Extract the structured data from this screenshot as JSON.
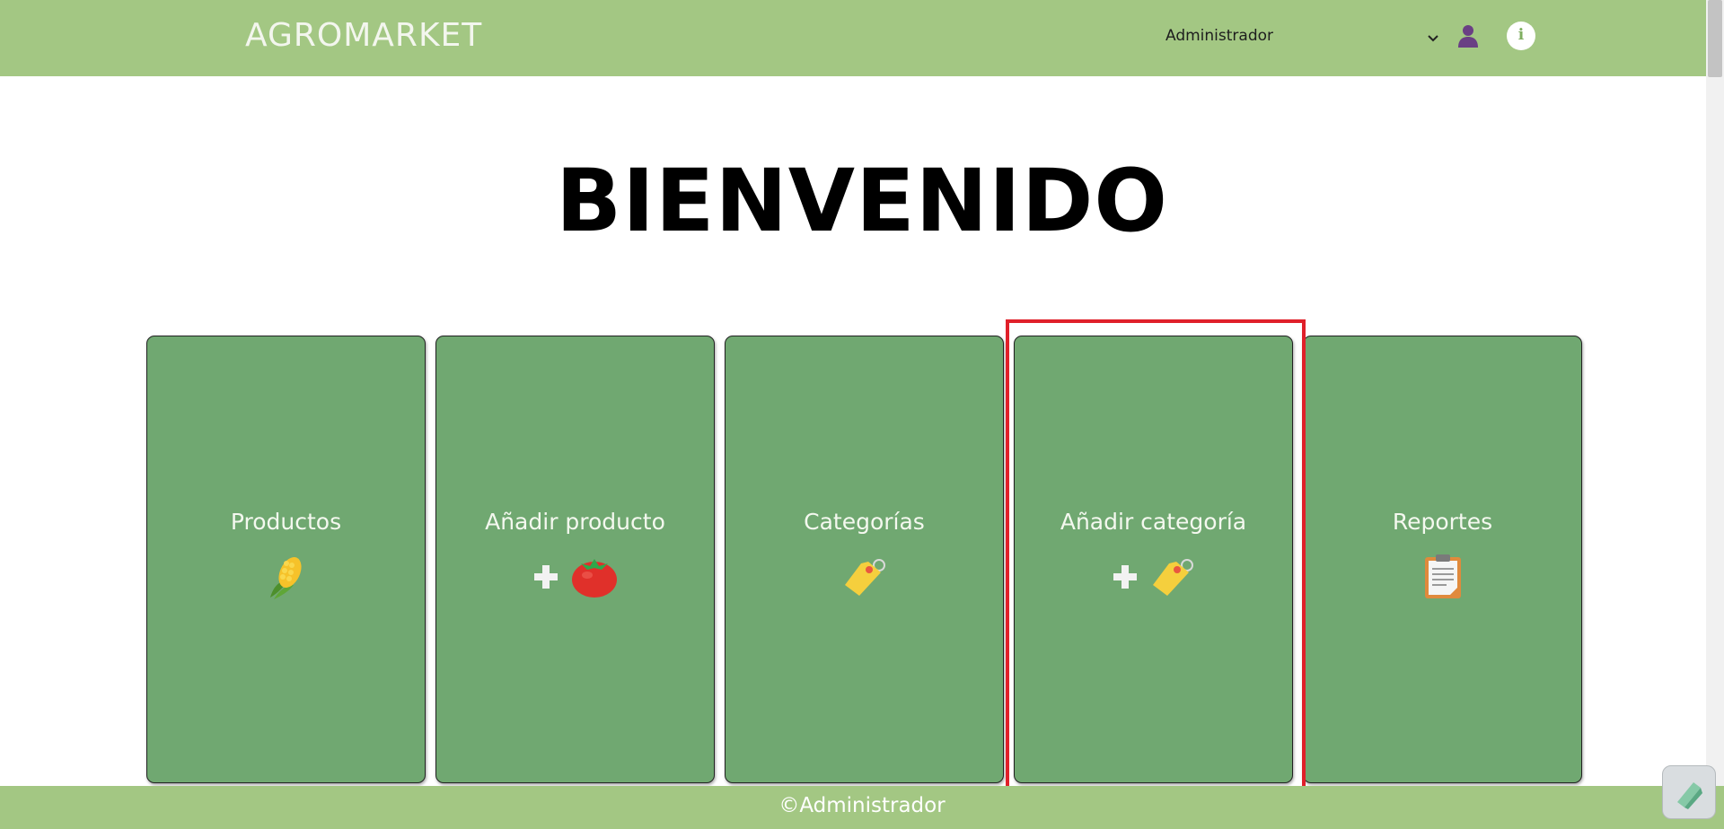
{
  "header": {
    "brand": "AGROMARKET",
    "user_select_value": "Administrador"
  },
  "main": {
    "title": "BIENVENIDO",
    "cards": [
      {
        "label": "Productos",
        "icons": [
          "corn-icon"
        ]
      },
      {
        "label": "Añadir producto",
        "icons": [
          "plus-icon",
          "tomato-icon"
        ]
      },
      {
        "label": "Categorías",
        "icons": [
          "tag-icon"
        ]
      },
      {
        "label": "Añadir categoría",
        "icons": [
          "plus-icon",
          "tag-icon"
        ]
      },
      {
        "label": "Reportes",
        "icons": [
          "clipboard-icon"
        ]
      }
    ]
  },
  "footer": {
    "text": "©Administrador"
  },
  "colors": {
    "header_bg": "#a3c783",
    "card_bg": "#70a871",
    "highlight": "#e0202a"
  }
}
